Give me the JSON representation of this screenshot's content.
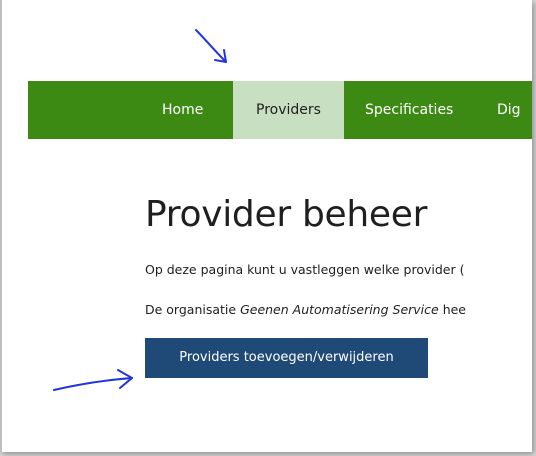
{
  "nav": {
    "items": [
      "Home",
      "Providers",
      "Specificaties",
      "Dig"
    ],
    "active_index": 1
  },
  "page": {
    "title": "Provider beheer",
    "intro_text": "Op deze pagina kunt u vastleggen welke provider (",
    "org_prefix": "De organisatie ",
    "org_name": "Geenen Automatisering Service",
    "org_suffix": " hee"
  },
  "actions": {
    "add_remove_label": "Providers toevoegen/verwijderen"
  },
  "colors": {
    "nav_green": "#3c8a14",
    "nav_active_bg": "#c9dfc1",
    "button_blue": "#1f4a78",
    "annotation_arrow": "#2233dd"
  },
  "annotations": [
    "arrow-pointing-to-providers-tab",
    "arrow-pointing-to-providers-button"
  ]
}
